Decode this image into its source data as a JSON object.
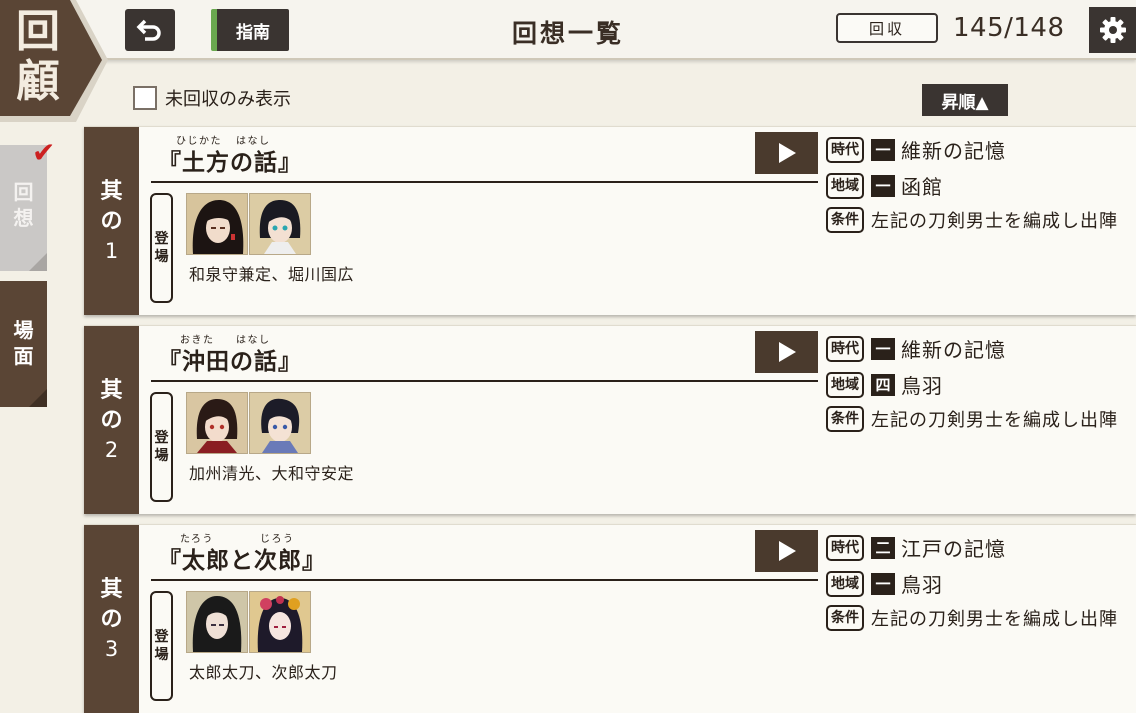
{
  "header": {
    "badge_chars": [
      "回",
      "顧"
    ],
    "guide_label": "指南",
    "title": "回想一覧",
    "collect_label": "回収",
    "count": "145/148"
  },
  "filter": {
    "label": "未回収のみ表示",
    "checked": false
  },
  "sort": {
    "label": "昇順▲"
  },
  "sidebar": {
    "tabs": [
      {
        "chars": [
          "回",
          "想"
        ],
        "active": true,
        "checked": true
      },
      {
        "chars": [
          "場",
          "面"
        ],
        "active": false,
        "checked": false
      }
    ]
  },
  "labels": {
    "appear": [
      "登",
      "場"
    ],
    "era": "時代",
    "region": "地域",
    "condition": "条件"
  },
  "entries": [
    {
      "num_chars": [
        "其",
        "の"
      ],
      "num": "1",
      "title": "『土方の話』",
      "ruby_1": "ひじかた",
      "ruby_2": "はなし",
      "names": "和泉守兼定、堀川国広",
      "era_num": "一",
      "era": "維新の記憶",
      "region_num": "一",
      "region": "函館",
      "condition": "左記の刀剣男士を編成し出陣"
    },
    {
      "num_chars": [
        "其",
        "の"
      ],
      "num": "2",
      "title": "『沖田の話』",
      "ruby_1": "おきた",
      "ruby_2": "はなし",
      "names": "加州清光、大和守安定",
      "era_num": "一",
      "era": "維新の記憶",
      "region_num": "四",
      "region": "鳥羽",
      "condition": "左記の刀剣男士を編成し出陣"
    },
    {
      "num_chars": [
        "其",
        "の"
      ],
      "num": "3",
      "title": "『太郎と次郎』",
      "ruby_1": "たろう",
      "ruby_2": "じろう",
      "names": "太郎太刀、次郎太刀",
      "era_num": "二",
      "era": "江戸の記憶",
      "region_num": "一",
      "region": "鳥羽",
      "condition": "左記の刀剣男士を編成し出陣"
    }
  ]
}
